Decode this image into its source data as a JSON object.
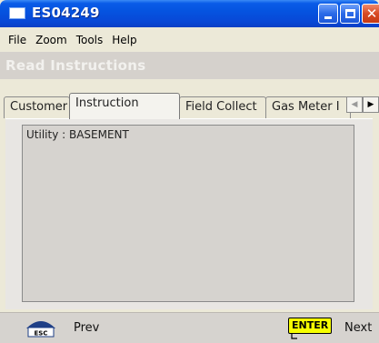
{
  "window": {
    "title": "ES04249",
    "colors": {
      "titlebar": "#0554e0",
      "close": "#d84a24",
      "face": "#ece9d8"
    }
  },
  "menubar": {
    "items": [
      {
        "label": "File"
      },
      {
        "label": "Zoom"
      },
      {
        "label": "Tools"
      },
      {
        "label": "Help"
      }
    ]
  },
  "section": {
    "title": "Read Instructions"
  },
  "tabs": [
    {
      "label": "Customer",
      "active": false
    },
    {
      "label": "Instruction",
      "active": true
    },
    {
      "label": "Field Collect",
      "active": false
    },
    {
      "label": "Gas Meter I",
      "active": false
    }
  ],
  "tab_scroll": {
    "left_icon": "arrow-left-icon",
    "right_icon": "arrow-right-icon"
  },
  "instruction": {
    "text": "Utility : BASEMENT"
  },
  "bottombar": {
    "esc_icon": "esc-key-icon",
    "esc_text": "ESC",
    "prev_label": "Prev",
    "enter_text": "ENTER",
    "next_label": "Next"
  }
}
